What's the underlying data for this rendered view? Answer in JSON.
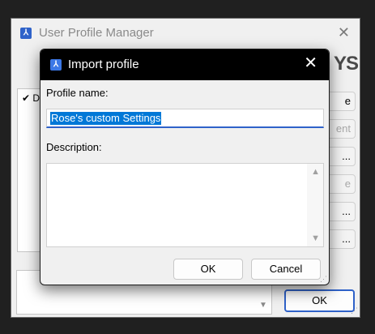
{
  "background_window": {
    "title": "User Profile Manager",
    "close_glyph": "✕",
    "logo_text": "YS",
    "profile_list_items": [
      {
        "check": "✔",
        "label": "D"
      }
    ],
    "side_buttons": [
      {
        "label": "e",
        "disabled": false
      },
      {
        "label": "ent",
        "disabled": true
      },
      {
        "label": "...",
        "disabled": false
      },
      {
        "label": "e",
        "disabled": true
      },
      {
        "label": "...",
        "disabled": false
      },
      {
        "label": "...",
        "disabled": false
      }
    ],
    "ok_label": "OK"
  },
  "dialog": {
    "title": "Import profile",
    "close_glyph": "✕",
    "profile_name_label": "Profile name:",
    "profile_name_value": "Rose's custom Settings",
    "description_label": "Description:",
    "description_value": "",
    "ok_label": "OK",
    "cancel_label": "Cancel"
  },
  "colors": {
    "accent": "#2f62c9",
    "selection": "#0078d7",
    "dialog_titlebar": "#000000"
  }
}
